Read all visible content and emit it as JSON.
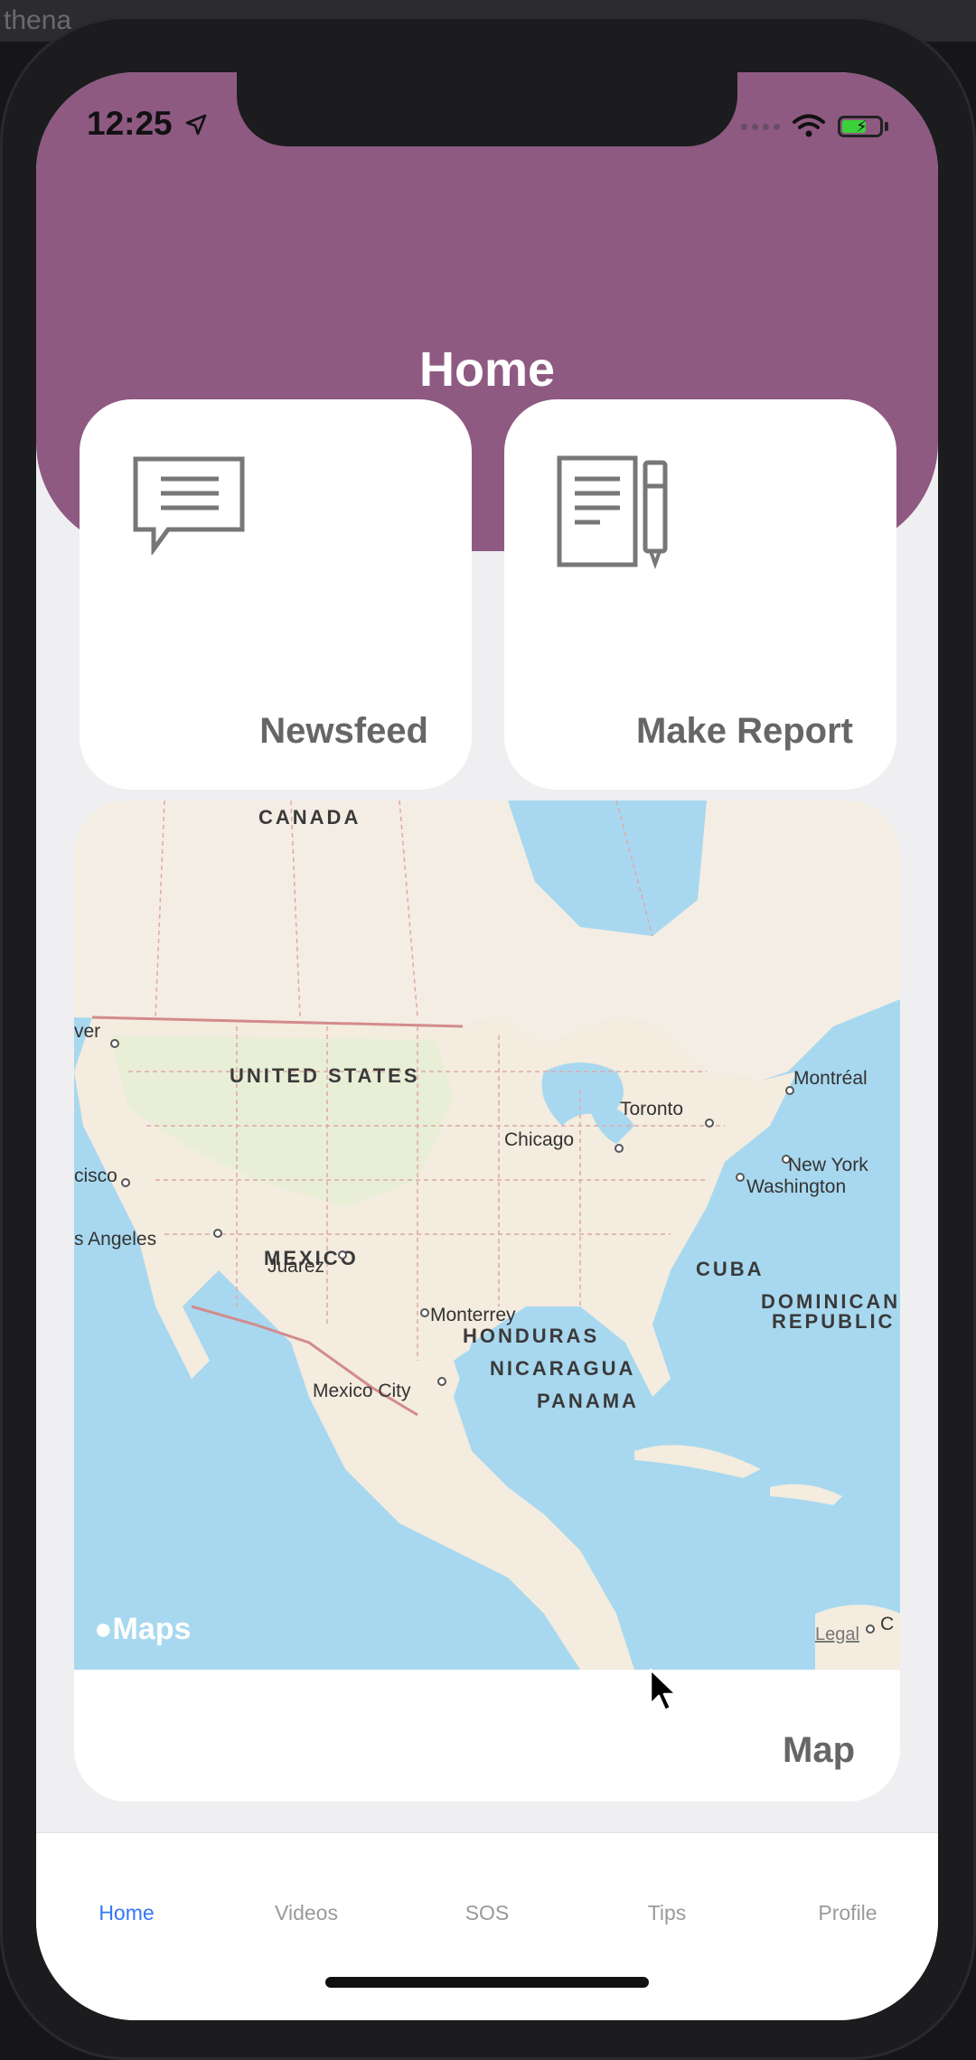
{
  "host": {
    "window_text": "thena"
  },
  "status_bar": {
    "time": "12:25"
  },
  "header": {
    "title": "Home"
  },
  "cards": {
    "newsfeed": {
      "label": "Newsfeed",
      "icon": "chat-bubble-icon"
    },
    "make_report": {
      "label": "Make Report",
      "icon": "notepad-pen-icon"
    },
    "map": {
      "label": "Map",
      "icon": "map"
    }
  },
  "map": {
    "attribution": "Maps",
    "legal": "Legal",
    "countries": [
      "CANADA",
      "UNITED STATES",
      "MEXICO",
      "CUBA",
      "DOMINICAN",
      "REPUBLIC",
      "HONDURAS",
      "NICARAGUA",
      "PANAMA"
    ],
    "cities": [
      "Toronto",
      "Montréal",
      "Chicago",
      "New York",
      "Washington",
      "Juárez",
      "Monterrey",
      "Mexico City",
      "s Angeles",
      "ver",
      "cisco",
      "C"
    ]
  },
  "tabbar": {
    "tabs": [
      {
        "label": "Home",
        "active": true
      },
      {
        "label": "Videos",
        "active": false
      },
      {
        "label": "SOS",
        "active": false
      },
      {
        "label": "Tips",
        "active": false
      },
      {
        "label": "Profile",
        "active": false
      }
    ]
  },
  "colors": {
    "header": "#8e5a82",
    "active_tab": "#3478f6"
  }
}
